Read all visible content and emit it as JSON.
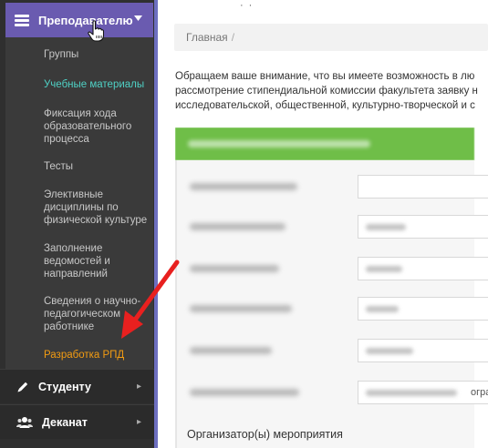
{
  "sidebar": {
    "header": {
      "label": "Преподавателю",
      "icon": "hamburger-icon"
    },
    "submenu": [
      {
        "id": "groups",
        "label": "Группы",
        "state": "normal"
      },
      {
        "id": "study-materials",
        "label": "Учебные материалы",
        "state": "active"
      },
      {
        "id": "progress-tracking",
        "label": "Фиксация хода образовательного процесса",
        "state": "normal"
      },
      {
        "id": "tests",
        "label": "Тесты",
        "state": "normal"
      },
      {
        "id": "elective-pe",
        "label": "Элективные дисциплины по физической культуре",
        "state": "normal"
      },
      {
        "id": "statements",
        "label": "Заполнение ведомостей и направлений",
        "state": "normal"
      },
      {
        "id": "staff-info",
        "label": "Сведения о научно-педагогическом работнике",
        "state": "normal"
      },
      {
        "id": "rpd-development",
        "label": "Разработка РПД",
        "state": "highlight"
      }
    ],
    "main_items": [
      {
        "id": "student",
        "label": "Студенту",
        "icon": "pencil-icon"
      },
      {
        "id": "dean",
        "label": "Деканат",
        "icon": "users-icon"
      }
    ]
  },
  "breadcrumb": {
    "home": "Главная",
    "separator": "/"
  },
  "notice": {
    "lines": [
      "Обращаем ваше внимание, что вы имеете возможность в лю",
      "рассмотрение стипендиальной комиссии факультета заявку н",
      "исследовательской, общественной, культурно-творческой и с"
    ]
  },
  "form": {
    "cut_text": "огра",
    "organizer_label": "Организатор(ы) мероприятия"
  },
  "colors": {
    "sidebar_bg": "#2f2f2f",
    "header_bg": "#6a5bb0",
    "active_item": "#4fd1c5",
    "highlight_item": "#f39c12",
    "form_header": "#6fbe48",
    "arrow": "#e8201f"
  }
}
